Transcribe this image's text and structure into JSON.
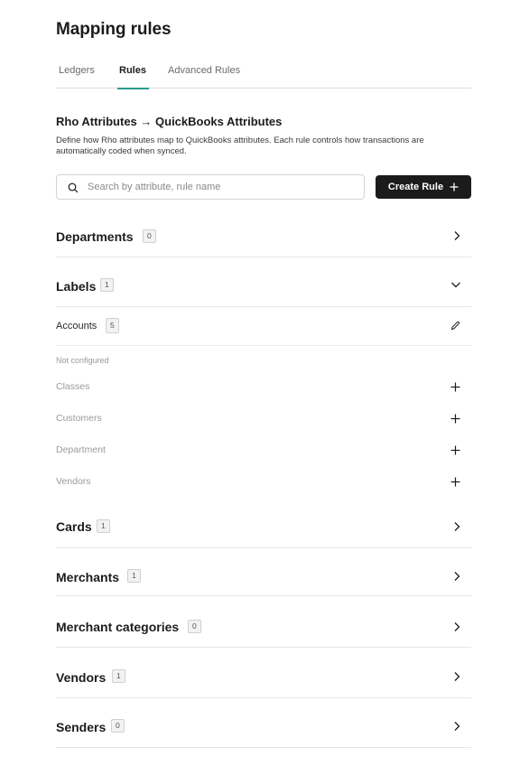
{
  "page": {
    "title": "Mapping rules"
  },
  "tabs": [
    {
      "label": "Ledgers",
      "active": false
    },
    {
      "label": "Rules",
      "active": true
    },
    {
      "label": "Advanced Rules",
      "active": false
    }
  ],
  "section": {
    "title": "Rho Attributes → QuickBooks Attributes",
    "description": "Define how Rho attributes map to QuickBooks attributes. Each rule controls how transactions are automatically coded when synced."
  },
  "search": {
    "placeholder": "Search by attribute, rule name",
    "value": ""
  },
  "create_button": {
    "label": "Create Rule"
  },
  "groups": {
    "departments": {
      "label": "Departments",
      "count": "0",
      "expanded": false
    },
    "labels": {
      "label": "Labels",
      "count": "1",
      "expanded": true,
      "configured": [
        {
          "label": "Accounts",
          "count": "5"
        }
      ],
      "not_configured_heading": "Not configured",
      "not_configured": [
        "Classes",
        "Customers",
        "Department",
        "Vendors"
      ]
    },
    "cards": {
      "label": "Cards",
      "count": "1",
      "expanded": false
    },
    "merchants": {
      "label": "Merchants",
      "count": "1",
      "expanded": false
    },
    "merchant_categories": {
      "label": "Merchant categories",
      "count": "0",
      "expanded": false
    },
    "vendors": {
      "label": "Vendors",
      "count": "1",
      "expanded": false
    },
    "senders": {
      "label": "Senders",
      "count": "0",
      "expanded": false
    }
  },
  "icons": {
    "search": "search-icon",
    "plus": "plus-icon",
    "chevron_right": "chevron-right-icon",
    "chevron_down": "chevron-down-icon",
    "edit": "pencil-icon"
  },
  "colors": {
    "accent": "#2a9d8f",
    "button_bg": "#1b1b1b"
  }
}
